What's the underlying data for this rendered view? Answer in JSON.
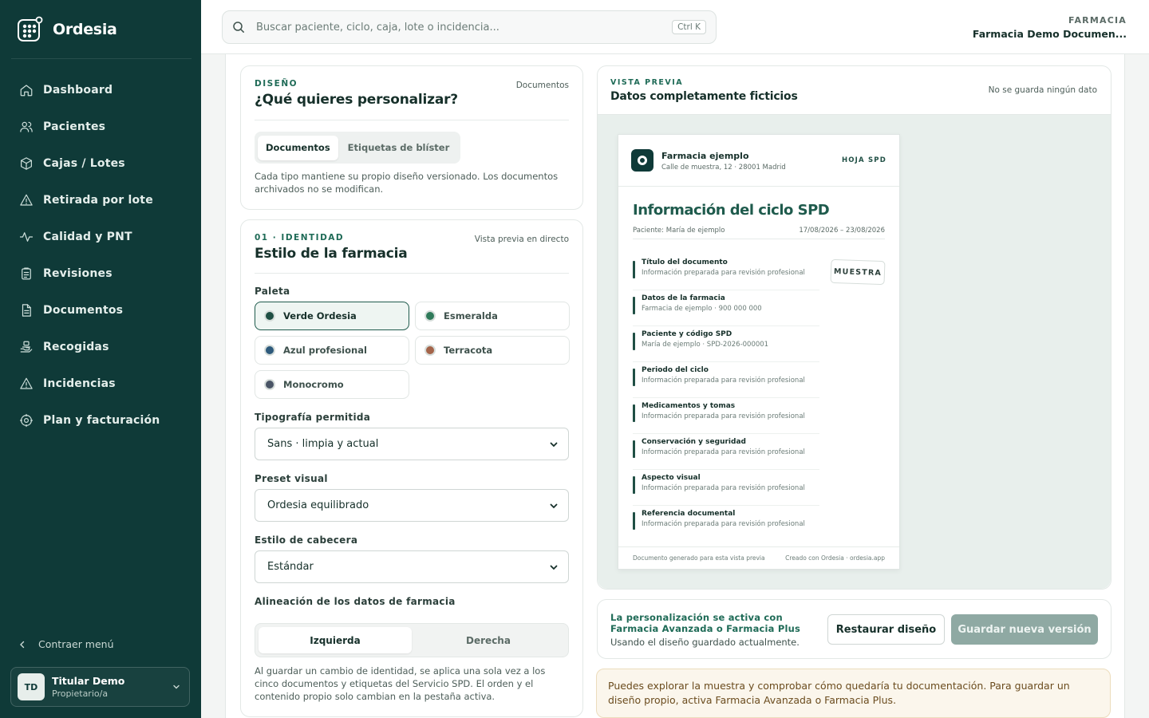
{
  "brand": {
    "name": "Ordesia"
  },
  "sidebar": {
    "items": [
      {
        "label": "Dashboard",
        "icon": "home-icon"
      },
      {
        "label": "Pacientes",
        "icon": "users-icon"
      },
      {
        "label": "Cajas / Lotes",
        "icon": "box-icon"
      },
      {
        "label": "Retirada por lote",
        "icon": "warning-icon"
      },
      {
        "label": "Calidad y PNT",
        "icon": "activity-icon"
      },
      {
        "label": "Revisiones",
        "icon": "clipboard-icon"
      },
      {
        "label": "Documentos",
        "icon": "document-icon"
      },
      {
        "label": "Recogidas",
        "icon": "hand-package-icon"
      },
      {
        "label": "Incidencias",
        "icon": "alert-icon"
      },
      {
        "label": "Plan y facturación",
        "icon": "gear-icon"
      }
    ],
    "collapse_label": "Contraer menú",
    "user": {
      "initials": "TD",
      "name": "Titular Demo",
      "role": "Propietario/a"
    }
  },
  "topbar": {
    "search_placeholder": "Buscar paciente, ciclo, caja, lote o incidencia...",
    "shortcut": "Ctrl K",
    "pharmacy_label": "FARMACIA",
    "pharmacy_name": "Farmacia Demo Documen..."
  },
  "design_card": {
    "kicker": "DISEÑO",
    "title": "¿Qué quieres personalizar?",
    "meta": "Documentos",
    "tabs": [
      "Documentos",
      "Etiquetas de blíster"
    ],
    "help": "Cada tipo mantiene su propio diseño versionado. Los documentos archivados no se modifican."
  },
  "identity_card": {
    "kicker": "01 · IDENTIDAD",
    "title": "Estilo de la farmacia",
    "meta": "Vista previa en directo",
    "palette_label": "Paleta",
    "palettes": [
      {
        "label": "Verde Ordesia",
        "color": "#1f4f44"
      },
      {
        "label": "Esmeralda",
        "color": "#2f7a5a"
      },
      {
        "label": "Azul profesional",
        "color": "#2e5a7c"
      },
      {
        "label": "Terracota",
        "color": "#a4644a"
      },
      {
        "label": "Monocromo",
        "color": "#4a5566"
      }
    ],
    "typography_label": "Tipografía permitida",
    "typography_value": "Sans · limpia y actual",
    "preset_label": "Preset visual",
    "preset_value": "Ordesia equilibrado",
    "header_label": "Estilo de cabecera",
    "header_value": "Estándar",
    "align_label": "Alineación de los datos de farmacia",
    "align_options": [
      "Izquierda",
      "Derecha"
    ],
    "help": "Al guardar un cambio de identidad, se aplica una sola vez a los cinco documentos y etiquetas del Servicio SPD. El orden y el contenido propio solo cambian en la pestaña activa."
  },
  "preview": {
    "kicker": "VISTA PREVIA",
    "title": "Datos completamente ficticios",
    "meta": "No se guarda ningún dato",
    "doc": {
      "pharmacy": "Farmacia ejemplo",
      "address": "Calle de muestra, 12 · 28001 Madrid",
      "tag": "HOJA SPD",
      "title": "Información del ciclo SPD",
      "patient": "Paciente: María de ejemplo",
      "dates": "17/08/2026 – 23/08/2026",
      "stamp": "MUESTRA",
      "rows": [
        {
          "title": "Título del documento",
          "sub": "Información preparada para revisión profesional"
        },
        {
          "title": "Datos de la farmacia",
          "sub": "Farmacia de ejemplo · 900 000 000"
        },
        {
          "title": "Paciente y código SPD",
          "sub": "María de ejemplo · SPD-2026-000001"
        },
        {
          "title": "Periodo del ciclo",
          "sub": "Información preparada para revisión profesional"
        },
        {
          "title": "Medicamentos y tomas",
          "sub": "Información preparada para revisión profesional"
        },
        {
          "title": "Conservación y seguridad",
          "sub": "Información preparada para revisión profesional"
        },
        {
          "title": "Aspecto visual",
          "sub": "Información preparada para revisión profesional"
        },
        {
          "title": "Referencia documental",
          "sub": "Información preparada para revisión profesional"
        }
      ],
      "footer_left": "Documento generado para esta vista previa",
      "footer_right": "Creado con Ordesia · ordesia.app"
    }
  },
  "actions": {
    "title": "La personalización se activa con Farmacia Avanzada o Farmacia Plus",
    "subtitle": "Usando el diseño guardado actualmente.",
    "restore_label": "Restaurar diseño",
    "save_label": "Guardar nueva versión"
  },
  "notice": {
    "text": "Puedes explorar la muestra y comprobar cómo quedaría tu documentación. Para guardar un diseño propio, activa Farmacia Avanzada o Farmacia Plus."
  }
}
